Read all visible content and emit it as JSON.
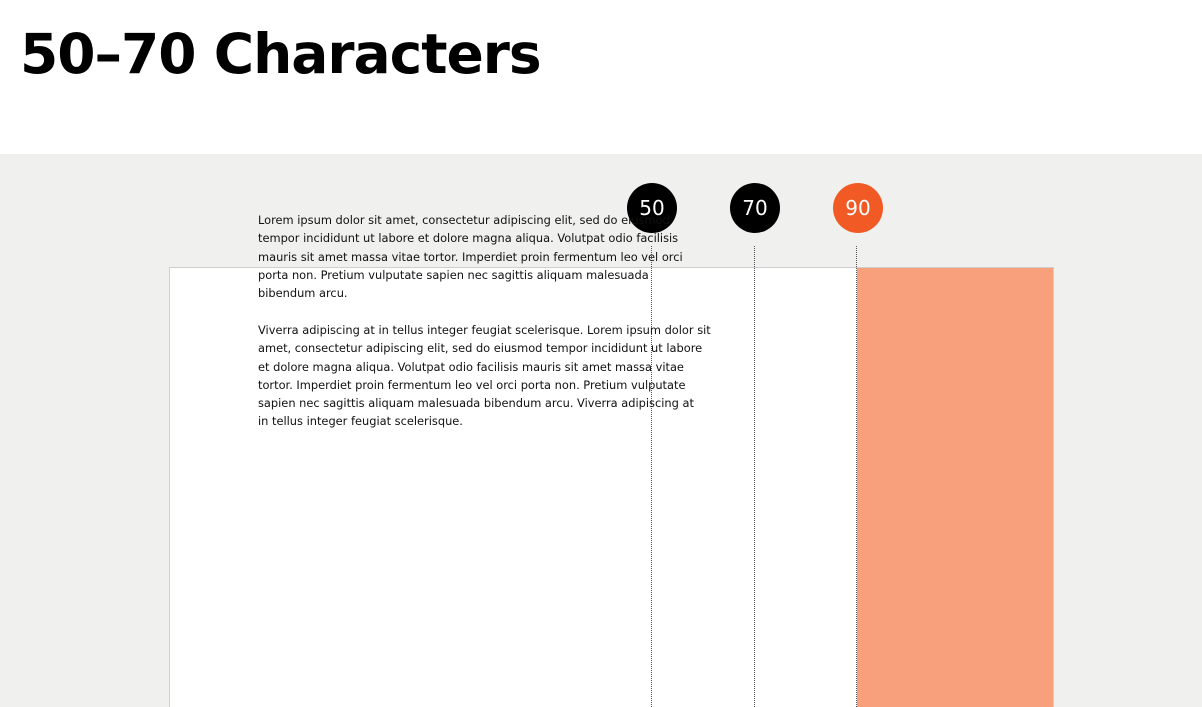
{
  "title": "50–70 Characters",
  "colors": {
    "background": "#f0f0ee",
    "page": "#ffffff",
    "marker_default": "#000000",
    "marker_highlight": "#f15a24",
    "overflow_zone": "#f8a07b"
  },
  "markers": [
    {
      "label": "50",
      "color": "#000000"
    },
    {
      "label": "70",
      "color": "#000000"
    },
    {
      "label": "90",
      "color": "#f15a24"
    }
  ],
  "paragraphs": [
    "Lorem ipsum dolor sit amet, consectetur adipiscing elit, sed do eiusmod\ntempor incididunt ut labore et dolore magna aliqua. Volutpat odio facilisis\nmauris sit amet massa vitae tortor. Imperdiet proin fermentum leo vel orci\nporta non. Pretium vulputate sapien nec sagittis aliquam malesuada\nbibendum arcu.",
    "Viverra adipiscing at in tellus integer feugiat scelerisque. Lorem ipsum dolor sit\namet, consectetur adipiscing elit, sed do eiusmod tempor incididunt ut labore\net dolore magna aliqua. Volutpat odio facilisis mauris sit amet massa vitae\ntortor. Imperdiet proin fermentum leo vel orci porta non. Pretium vulputate\nsapien nec sagittis aliquam malesuada bibendum arcu. Viverra adipiscing at\nin tellus integer feugiat scelerisque."
  ]
}
